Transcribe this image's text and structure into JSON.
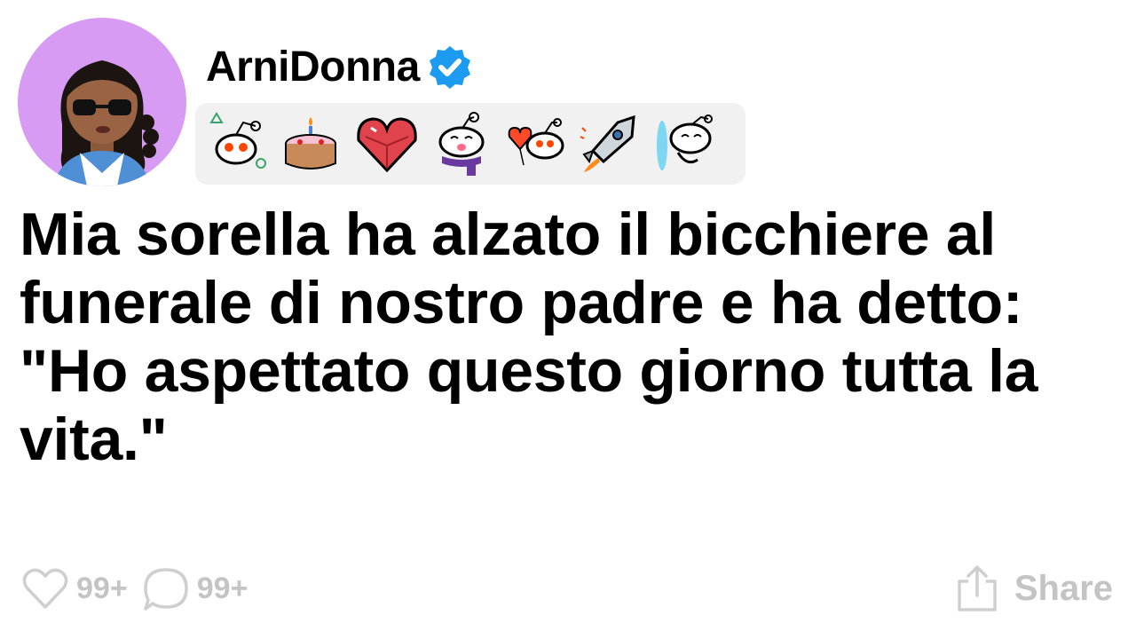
{
  "post": {
    "author": {
      "username": "ArniDonna",
      "verified": true,
      "avatar_bg": "#d79bf4",
      "verified_color": "#1d9bf0"
    },
    "badges": [
      {
        "icon": "snoo-shapes-badge-icon"
      },
      {
        "icon": "birthday-cake-badge-icon"
      },
      {
        "icon": "crystal-heart-badge-icon"
      },
      {
        "icon": "snoo-scarf-badge-icon"
      },
      {
        "icon": "snoo-heart-balloon-badge-icon"
      },
      {
        "icon": "rocket-badge-icon"
      },
      {
        "icon": "snoo-portal-badge-icon"
      }
    ],
    "title": "Mia sorella ha alzato il bicchiere al funerale di nostro padre e ha detto: \"Ho aspettato questo giorno tutta la vita.\"",
    "likes": "99+",
    "comments": "99+",
    "share_label": "Share"
  }
}
